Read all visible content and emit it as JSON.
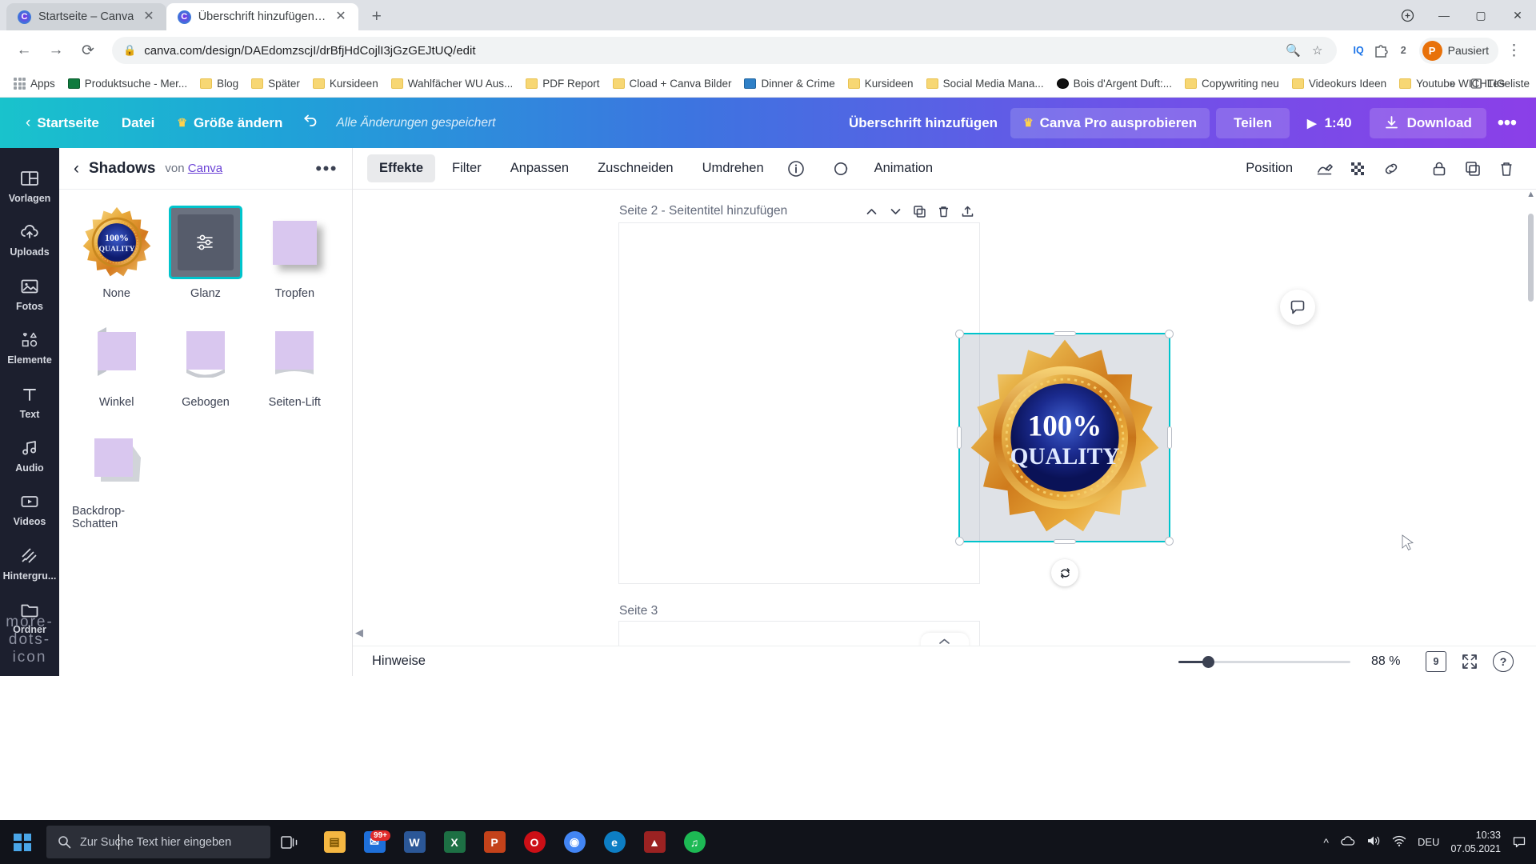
{
  "browser": {
    "tabs": [
      {
        "title": "Startseite – Canva",
        "active": false
      },
      {
        "title": "Überschrift hinzufügen – Logo",
        "active": true
      }
    ],
    "new_tab_label": "+",
    "window_controls": {
      "minimize": "—",
      "maximize": "▢",
      "close": "✕"
    },
    "nav": {
      "back": "←",
      "forward": "→",
      "reload": "⟳"
    },
    "address": {
      "lock_icon": "lock-icon",
      "url": "canva.com/design/DAEdomzscjI/drBfjHdCojlI3jGzGEJtUQ/edit",
      "zoom_icon": "zoom-icon",
      "star_icon": "star-icon"
    },
    "extensions": [
      {
        "name": "iq-extension",
        "label": "IQ"
      },
      {
        "name": "puzzle-extension",
        "label": ""
      },
      {
        "name": "extension-count",
        "label": "2"
      }
    ],
    "profile": {
      "avatar_initial": "P",
      "label": "Pausiert"
    },
    "menu_icon": "kebab-menu-icon",
    "bookmarks": [
      {
        "label": "Apps",
        "icon": "apps-grid-icon"
      },
      {
        "label": "Produktsuche - Mer...",
        "icon": "green-folder-icon"
      },
      {
        "label": "Blog",
        "icon": "folder-icon"
      },
      {
        "label": "Später",
        "icon": "folder-icon"
      },
      {
        "label": "Kursideen",
        "icon": "folder-icon"
      },
      {
        "label": "Wahlfächer WU Aus...",
        "icon": "folder-icon"
      },
      {
        "label": "PDF Report",
        "icon": "folder-icon"
      },
      {
        "label": "Cload + Canva Bilder",
        "icon": "folder-icon"
      },
      {
        "label": "Dinner & Crime",
        "icon": "blue-site-icon"
      },
      {
        "label": "Kursideen",
        "icon": "folder-icon"
      },
      {
        "label": "Social Media Mana...",
        "icon": "folder-icon"
      },
      {
        "label": "Bois d'Argent Duft:...",
        "icon": "black-site-icon"
      },
      {
        "label": "Copywriting neu",
        "icon": "folder-icon"
      },
      {
        "label": "Videokurs Ideen",
        "icon": "folder-icon"
      },
      {
        "label": "Youtube WICHTIG",
        "icon": "folder-icon"
      }
    ],
    "bookmarks_overflow": "»",
    "reading_list": {
      "label": "Leseliste",
      "icon": "reading-list-icon"
    }
  },
  "canva_top": {
    "home": "Startseite",
    "file": "Datei",
    "resize": "Größe ändern",
    "undo_icon": "undo-arrow-icon",
    "saved_status": "Alle Änderungen gespeichert",
    "design_title": "Überschrift hinzufügen",
    "pro_button": "Canva Pro ausprobieren",
    "share_button": "Teilen",
    "present_time": "1:40",
    "download_button": "Download",
    "more_icon": "more-dots-icon"
  },
  "rail": {
    "items": [
      {
        "label": "Vorlagen",
        "icon": "templates-icon"
      },
      {
        "label": "Uploads",
        "icon": "upload-cloud-icon"
      },
      {
        "label": "Fotos",
        "icon": "photo-icon"
      },
      {
        "label": "Elemente",
        "icon": "shapes-icon"
      },
      {
        "label": "Text",
        "icon": "text-icon"
      },
      {
        "label": "Audio",
        "icon": "music-note-icon"
      },
      {
        "label": "Videos",
        "icon": "video-icon"
      },
      {
        "label": "Hintergru...",
        "icon": "background-icon"
      },
      {
        "label": "Ordner",
        "icon": "folder-icon"
      }
    ],
    "more_icon": "more-dots-icon"
  },
  "panel": {
    "back_icon": "chevron-left-icon",
    "title": "Shadows",
    "by_prefix": "von",
    "by_author": "Canva",
    "more_icon": "more-dots-icon",
    "shadows": [
      {
        "label": "None",
        "type": "badge-preview",
        "selected": false
      },
      {
        "label": "Glanz",
        "type": "sliders",
        "selected": true
      },
      {
        "label": "Tropfen",
        "type": "drop",
        "selected": false
      },
      {
        "label": "Winkel",
        "type": "angle",
        "selected": false
      },
      {
        "label": "Gebogen",
        "type": "curved",
        "selected": false
      },
      {
        "label": "Seiten-Lift",
        "type": "page-lift",
        "selected": false
      },
      {
        "label": "Backdrop-Schatten",
        "type": "backdrop",
        "selected": false
      }
    ]
  },
  "image_toolbar": {
    "tabs": [
      {
        "label": "Effekte",
        "active": true
      },
      {
        "label": "Filter",
        "active": false
      },
      {
        "label": "Anpassen",
        "active": false
      },
      {
        "label": "Zuschneiden",
        "active": false
      },
      {
        "label": "Umdrehen",
        "active": false
      }
    ],
    "info_icon": "info-icon",
    "animation_icon": "animation-icon",
    "animation_label": "Animation",
    "position_label": "Position",
    "right_icons": [
      "transparency-icon",
      "checker-icon",
      "link-icon",
      "lock-icon",
      "duplicate-icon",
      "trash-icon"
    ]
  },
  "canvas": {
    "page2_label": "Seite 2 - Seitentitel hinzufügen",
    "page3_label": "Seite 3",
    "page_icons": [
      "move-up-icon",
      "move-down-icon",
      "duplicate-page-icon",
      "delete-page-icon",
      "add-page-icon"
    ],
    "badge": {
      "top_text": "100%",
      "bottom_text": "QUALITY"
    },
    "rotate_icon": "rotate-icon",
    "comment_icon": "comment-icon",
    "collapse_icon": "collapse-left-icon",
    "bottom_arrow_icon": "chevron-up-icon"
  },
  "statusbar": {
    "notes_label": "Hinweise",
    "zoom_percent": "88 %",
    "zoom_value": 88,
    "page_count": "9",
    "expand_icon": "fullscreen-icon",
    "help_icon": "help-icon"
  },
  "taskbar": {
    "start_icon": "windows-start-icon",
    "search_placeholder": "Zur Suche Text hier eingeben",
    "search_icon": "search-icon",
    "task_view_icon": "task-view-icon",
    "apps": [
      {
        "name": "file-explorer",
        "glyph": "▤",
        "color": "#f5b742",
        "badge": ""
      },
      {
        "name": "mail",
        "glyph": "✉",
        "color": "#1e6fd9",
        "badge": "99+"
      },
      {
        "name": "word",
        "glyph": "W",
        "color": "#2b5797",
        "badge": ""
      },
      {
        "name": "excel",
        "glyph": "X",
        "color": "#1d7044",
        "badge": ""
      },
      {
        "name": "powerpoint",
        "glyph": "P",
        "color": "#c4421a",
        "badge": ""
      },
      {
        "name": "opera",
        "glyph": "O",
        "color": "#cc0f16",
        "badge": ""
      },
      {
        "name": "chrome",
        "glyph": "◉",
        "color": "#4285f4",
        "badge": ""
      },
      {
        "name": "edge",
        "glyph": "e",
        "color": "#0d7ec4",
        "badge": ""
      },
      {
        "name": "filezilla",
        "glyph": "▲",
        "color": "#9b2222",
        "badge": ""
      },
      {
        "name": "spotify",
        "glyph": "♫",
        "color": "#1db954",
        "badge": ""
      }
    ],
    "tray": {
      "chevron": "^",
      "onedrive_icon": "cloud-icon",
      "volume_icon": "volume-icon",
      "network_icon": "network-icon",
      "language": "DEU",
      "time": "10:33",
      "date": "07.05.2021",
      "notification_icon": "notification-icon"
    }
  }
}
